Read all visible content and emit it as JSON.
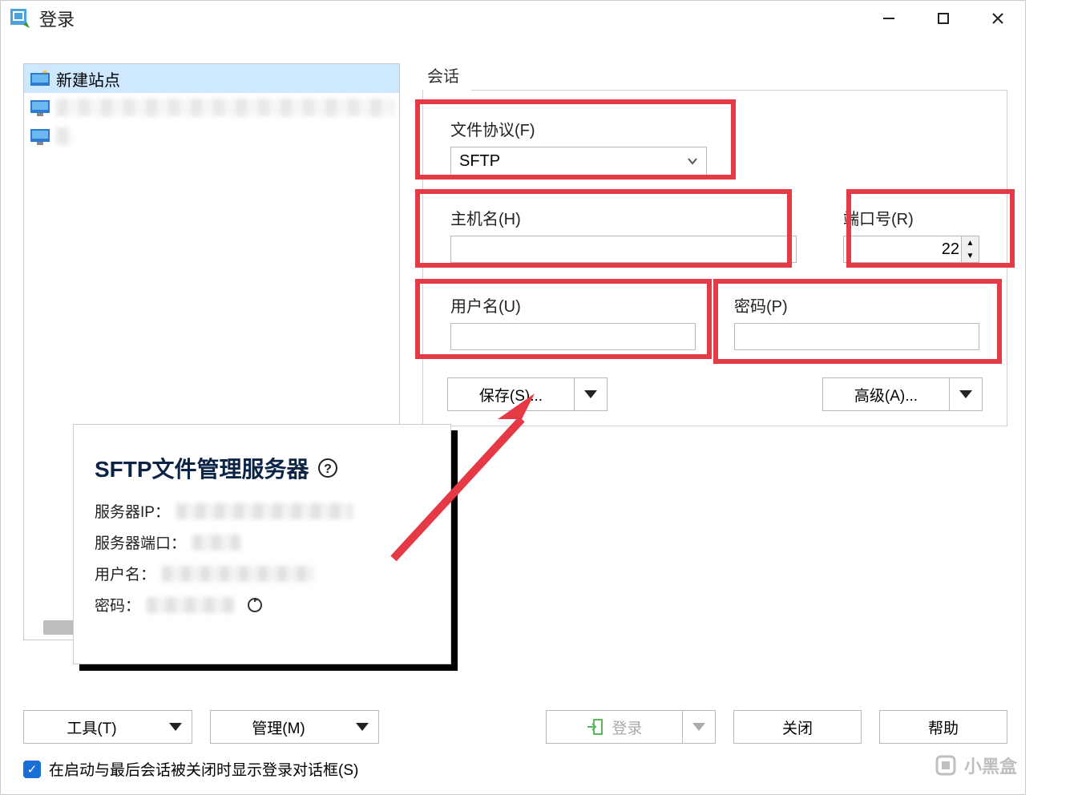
{
  "titlebar": {
    "title": "登录"
  },
  "sidebar": {
    "new_site": "新建站点"
  },
  "session": {
    "group_label": "会话",
    "protocol_label": "文件协议(F)",
    "protocol_value": "SFTP",
    "host_label": "主机名(H)",
    "host_value": "",
    "port_label": "端口号(R)",
    "port_value": "22",
    "user_label": "用户名(U)",
    "user_value": "",
    "pass_label": "密码(P)",
    "pass_value": "",
    "save_btn": "保存(S)...",
    "advanced_btn": "高级(A)..."
  },
  "overlay": {
    "title": "SFTP文件管理服务器",
    "ip_label": "服务器IP：",
    "port_label": "服务器端口：",
    "user_label": "用户名：",
    "pass_label": "密码："
  },
  "bottom": {
    "tools_btn": "工具(T)",
    "manage_btn": "管理(M)",
    "login_btn": "登录",
    "close_btn": "关闭",
    "help_btn": "帮助",
    "checkbox_label": "在启动与最后会话被关闭时显示登录对话框(S)"
  },
  "watermark": "小黑盒"
}
